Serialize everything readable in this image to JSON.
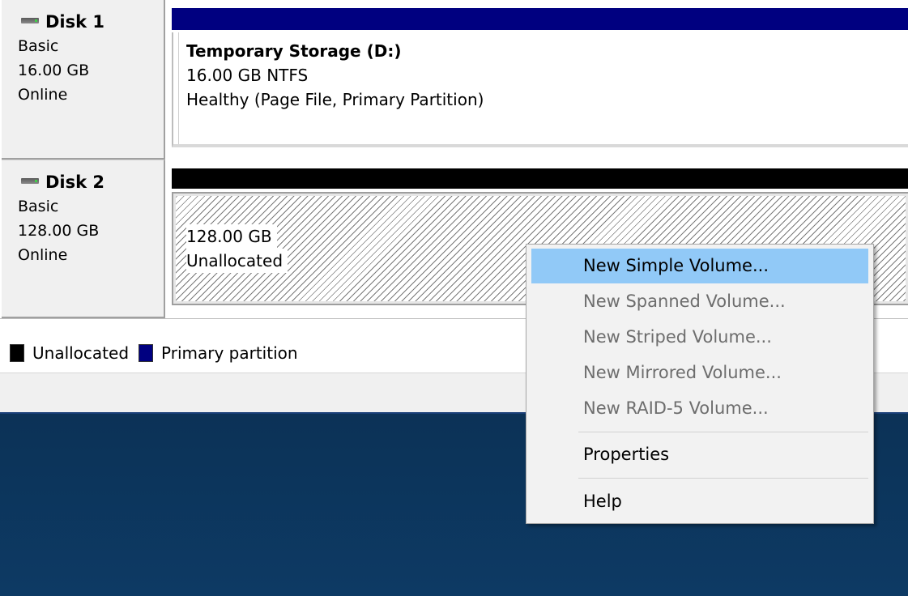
{
  "disks": [
    {
      "title": "Disk 1",
      "type": "Basic",
      "size": "16.00 GB",
      "status": "Online",
      "volume": {
        "name": "Temporary Storage  (D:)",
        "detail": "16.00 GB NTFS",
        "health": "Healthy (Page File, Primary Partition)",
        "header_color": "#000080"
      }
    },
    {
      "title": "Disk 2",
      "type": "Basic",
      "size": "128.00 GB",
      "status": "Online",
      "volume": {
        "size": "128.00 GB",
        "state": "Unallocated",
        "header_color": "#000000"
      }
    }
  ],
  "legend": {
    "items": [
      {
        "label": "Unallocated",
        "color": "#000000"
      },
      {
        "label": "Primary partition",
        "color": "#000080"
      }
    ]
  },
  "context_menu": {
    "items": [
      {
        "label": "New Simple Volume...",
        "enabled": true,
        "highlighted": true
      },
      {
        "label": "New Spanned Volume...",
        "enabled": false
      },
      {
        "label": "New Striped Volume...",
        "enabled": false
      },
      {
        "label": "New Mirrored Volume...",
        "enabled": false
      },
      {
        "label": "New RAID-5 Volume...",
        "enabled": false
      },
      {
        "label": "Properties",
        "enabled": true
      },
      {
        "label": "Help",
        "enabled": true
      }
    ],
    "highlight_color": "#91c9f7"
  }
}
